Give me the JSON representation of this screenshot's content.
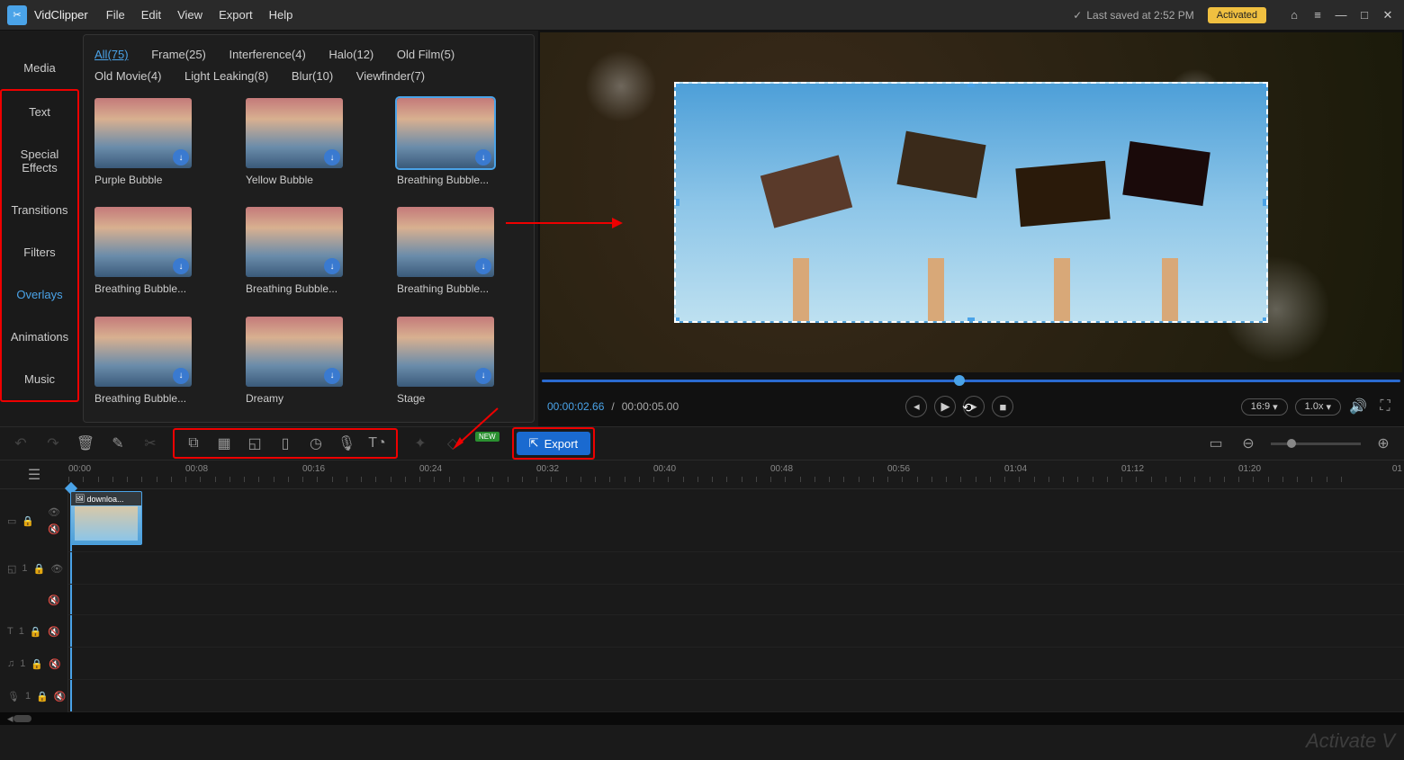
{
  "app": {
    "name": "VidClipper"
  },
  "menu": [
    "File",
    "Edit",
    "View",
    "Export",
    "Help"
  ],
  "status": {
    "save": "Last saved at 2:52 PM",
    "activated": "Activated"
  },
  "nav": {
    "items": [
      "Media",
      "Text",
      "Special Effects",
      "Transitions",
      "Filters",
      "Overlays",
      "Animations",
      "Music"
    ],
    "active": "Overlays"
  },
  "categories": [
    {
      "label": "All(75)",
      "active": true
    },
    {
      "label": "Frame(25)"
    },
    {
      "label": "Interference(4)"
    },
    {
      "label": "Halo(12)"
    },
    {
      "label": "Old Film(5)"
    },
    {
      "label": "Old Movie(4)"
    },
    {
      "label": "Light Leaking(8)"
    },
    {
      "label": "Blur(10)"
    },
    {
      "label": "Viewfinder(7)"
    }
  ],
  "thumbs": [
    {
      "label": "Purple Bubble"
    },
    {
      "label": "Yellow Bubble"
    },
    {
      "label": "Breathing Bubble...",
      "selected": true
    },
    {
      "label": "Breathing Bubble..."
    },
    {
      "label": "Breathing Bubble..."
    },
    {
      "label": "Breathing Bubble..."
    },
    {
      "label": "Breathing Bubble..."
    },
    {
      "label": "Dreamy"
    },
    {
      "label": "Stage"
    }
  ],
  "player": {
    "current": "00:00:02.66",
    "sep": " / ",
    "total": "00:00:05.00",
    "ratio": "16:9",
    "speed": "1.0x"
  },
  "toolbar": {
    "export": "Export",
    "new": "NEW"
  },
  "ruler": [
    "00:00",
    "00:08",
    "00:16",
    "00:24",
    "00:32",
    "00:40",
    "00:48",
    "00:56",
    "01:04",
    "01:12",
    "01:20"
  ],
  "clip": {
    "name": "downloa..."
  },
  "tracks": {
    "t2": "1",
    "t3": "1",
    "t4": "1",
    "t5": "1"
  },
  "watermark": "Activate V"
}
